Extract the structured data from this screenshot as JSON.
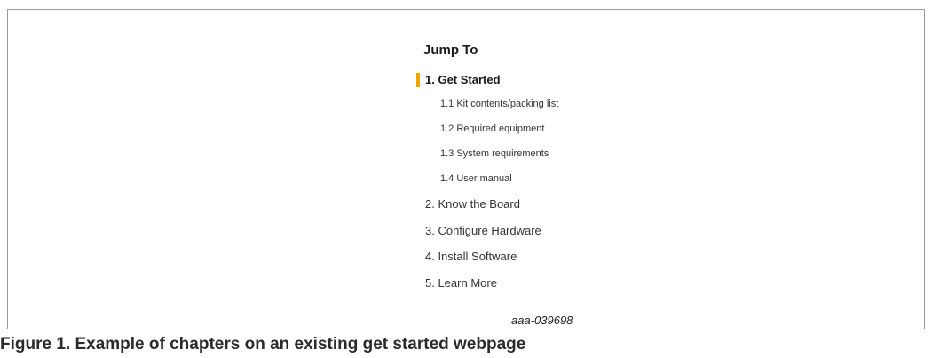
{
  "jump_to": {
    "title": "Jump To",
    "accent_color": "#f4a300",
    "active_chapter": {
      "label": "1. Get Started",
      "subitems": [
        {
          "label": "1.1 Kit contents/packing list"
        },
        {
          "label": "1.2 Required equipment"
        },
        {
          "label": "1.3 System requirements"
        },
        {
          "label": "1.4 User manual"
        }
      ]
    },
    "chapters": [
      {
        "label": "2. Know the Board"
      },
      {
        "label": "3. Configure Hardware"
      },
      {
        "label": "4. Install Software"
      },
      {
        "label": "5. Learn More"
      }
    ]
  },
  "figure": {
    "id": "aaa-039698",
    "caption": "Figure 1.  Example of chapters on an existing get started webpage"
  }
}
